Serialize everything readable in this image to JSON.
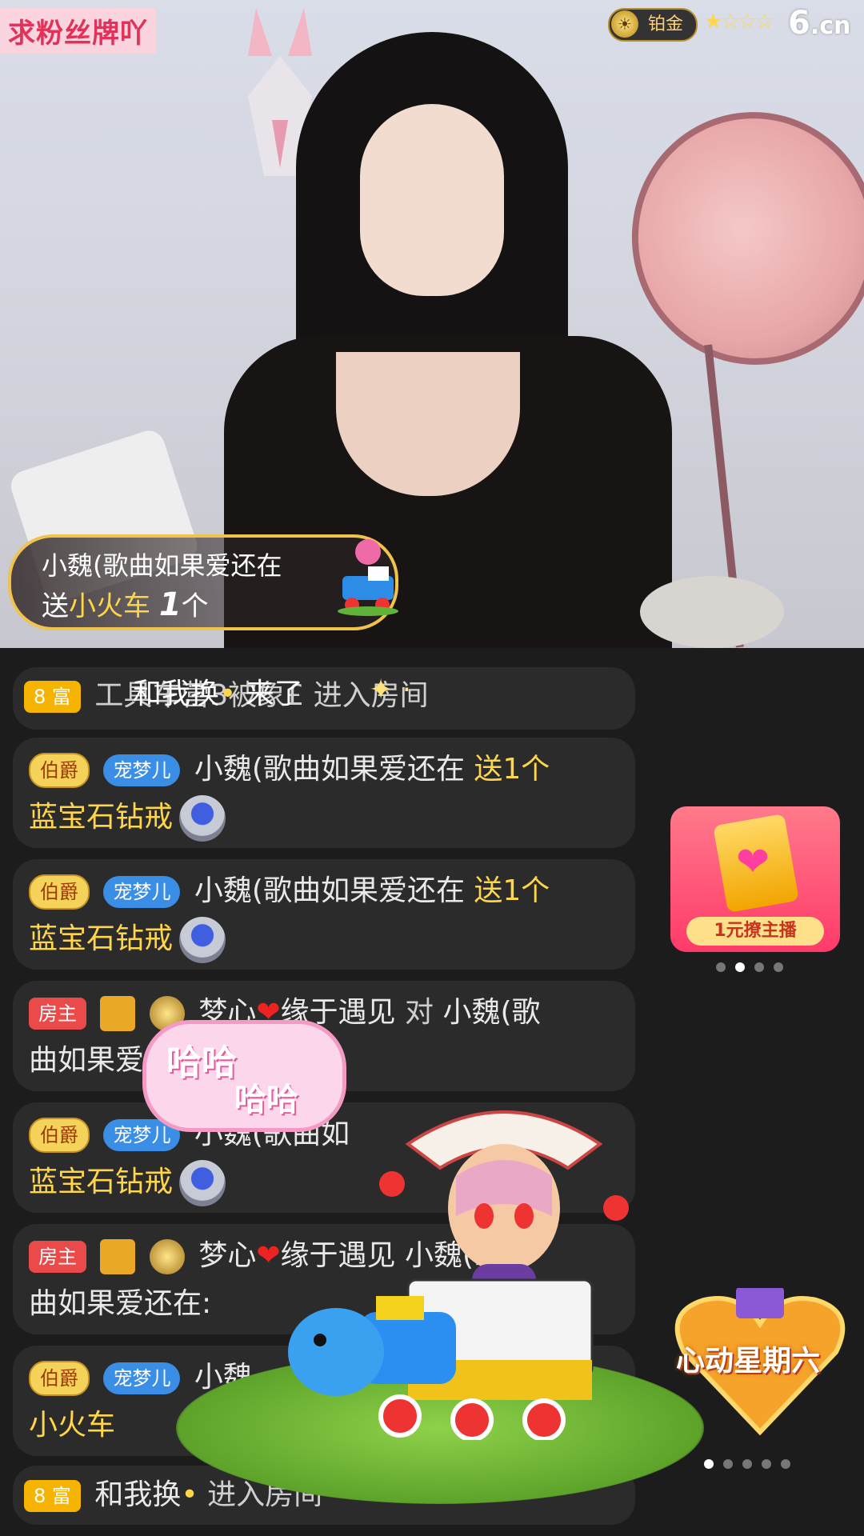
{
  "header": {
    "fan_badge_request": "求粉丝牌吖",
    "rank_label": "铂金",
    "rank_stars": "★☆☆☆",
    "site_logo": "6",
    "site_logo_suffix": ".cn"
  },
  "gift_banner": {
    "sender": "小魏(歌曲如果爱还在",
    "action": "送",
    "gift": "小火车",
    "count": "1",
    "unit": "个"
  },
  "chat": {
    "messages": [
      {
        "tag": "8 富",
        "overlay": "和我换",
        "text_a": "工具车营3被象£",
        "text_b": "来了",
        "text_c": "进入房间"
      },
      {
        "tag": "伯爵",
        "fan": "宠梦儿",
        "user": "小魏(歌曲如果爱还在",
        "action": "送1个",
        "gift": "蓝宝石钻戒"
      },
      {
        "tag": "伯爵",
        "fan": "宠梦儿",
        "user": "小魏(歌曲如果爱还在",
        "action": "送1个",
        "gift": "蓝宝石钻戒"
      },
      {
        "tag": "房主",
        "user": "梦心",
        "user2": "缘于遇见",
        "to": "对",
        "target": "小魏(歌",
        "line2": "曲如果爱"
      },
      {
        "tag": "伯爵",
        "fan": "宠梦儿",
        "user": "小魏(歌曲如",
        "gift": "蓝宝石钻戒"
      },
      {
        "tag": "房主",
        "user": "梦心",
        "user2": "缘于遇见",
        "target": "小魏(歌",
        "line2": "曲如果爱还在:"
      },
      {
        "tag": "伯爵",
        "fan": "宠梦儿",
        "user": "小魏",
        "gift": "小火车"
      },
      {
        "tag": "8 富",
        "user": "和我换",
        "text": "进入房间"
      }
    ]
  },
  "promo": {
    "label": "1元撩主播"
  },
  "event_badge": {
    "title": "心动星期六"
  },
  "animation": {
    "bubble_line1": "哈哈",
    "bubble_line2": "哈哈"
  }
}
